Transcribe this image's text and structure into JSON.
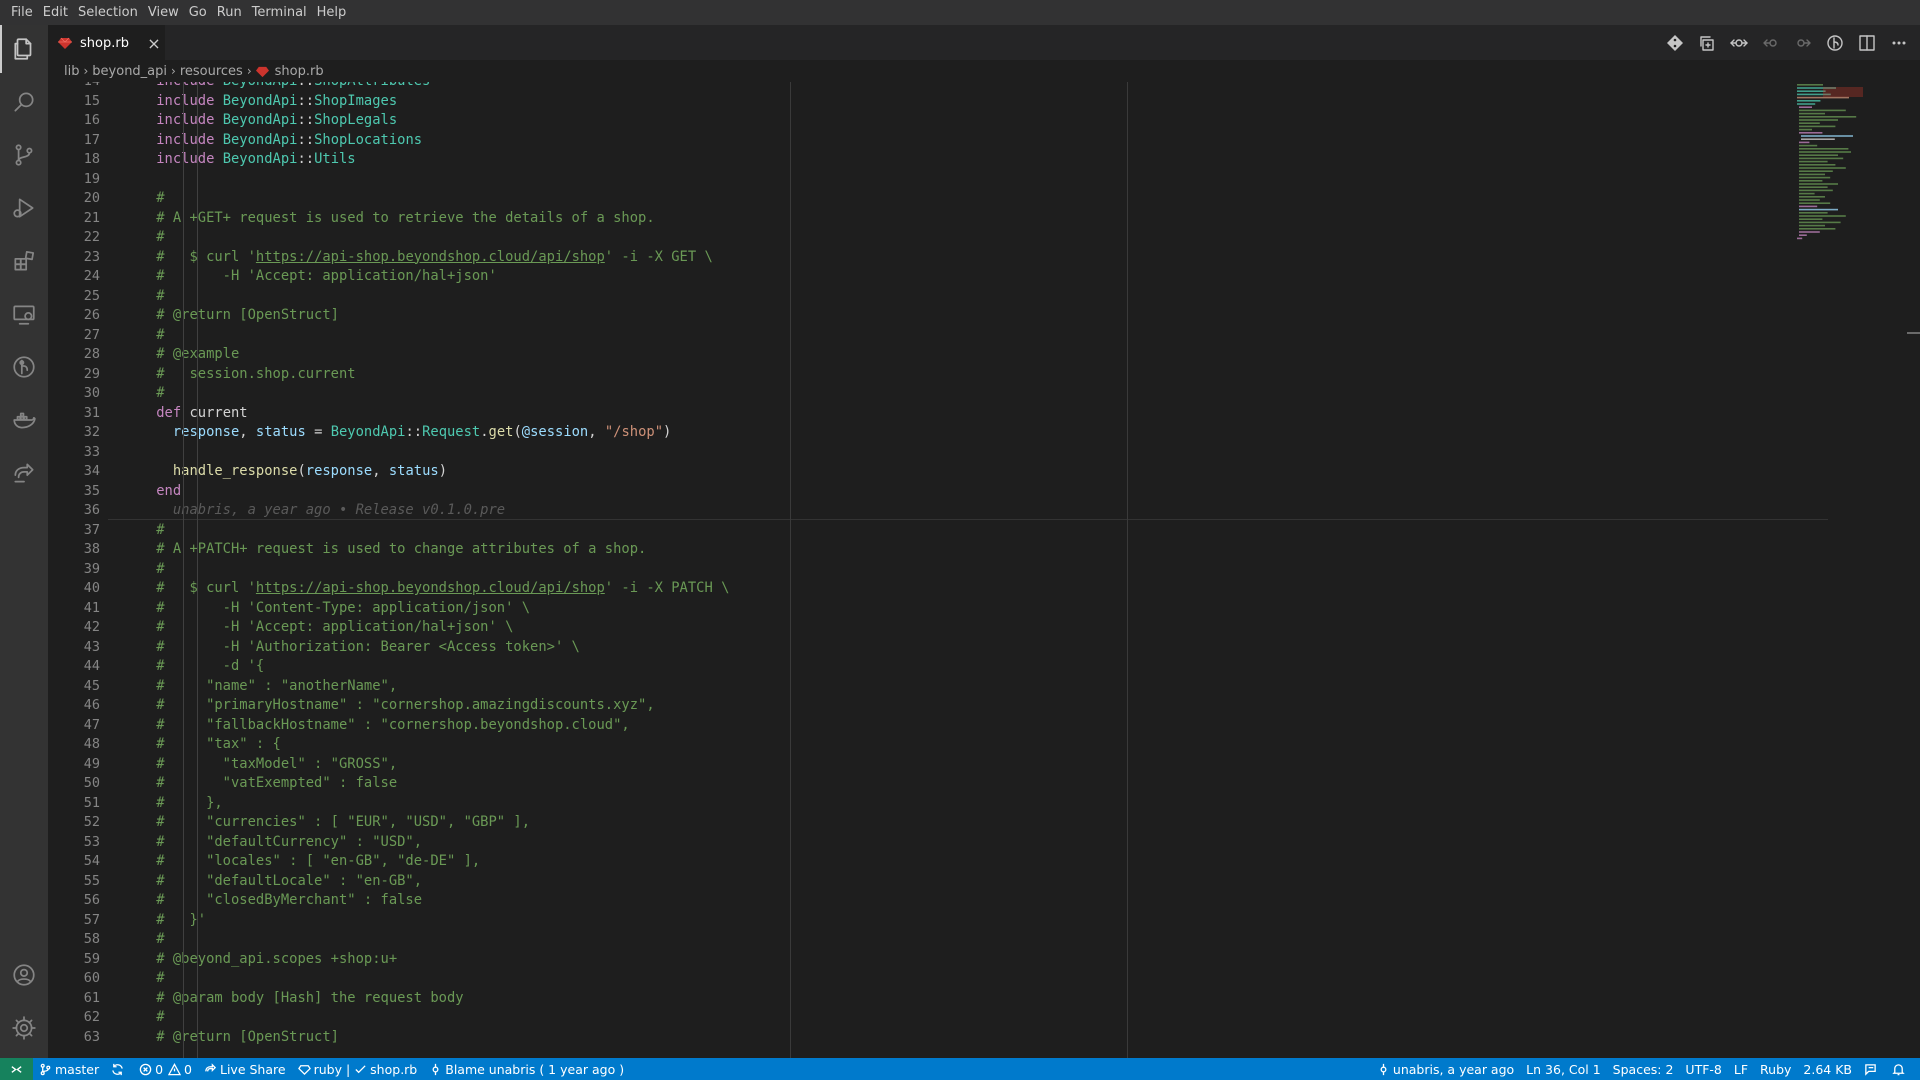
{
  "menu": [
    "File",
    "Edit",
    "Selection",
    "View",
    "Go",
    "Run",
    "Terminal",
    "Help"
  ],
  "tab": {
    "label": "shop.rb",
    "close": "×"
  },
  "breadcrumb": [
    "lib",
    "beyond_api",
    "resources",
    "shop.rb"
  ],
  "activity_icons": [
    "explorer-icon",
    "search-icon",
    "source-control-icon",
    "run-debug-icon",
    "extensions-icon",
    "remote-explorer-icon",
    "gitlens-icon",
    "docker-icon",
    "live-share-icon",
    "accounts-icon",
    "settings-gear-icon"
  ],
  "editor_action_icons": [
    "gitlens-compare-icon",
    "open-changes-icon",
    "toggle-blame-icon",
    "previous-change-icon",
    "next-change-icon",
    "gitlens-inspect-icon",
    "split-editor-icon",
    "more-actions-icon"
  ],
  "editor": {
    "first_line_number": 14,
    "blame_inline": "unabris, a year ago • Release v0.1.0.pre",
    "lines": [
      [
        [
          "    ",
          "plain"
        ],
        [
          "include ",
          "kw"
        ],
        [
          "BeyondApi",
          "cls"
        ],
        [
          "::",
          "plain"
        ],
        [
          "ShopAttributes",
          "cls"
        ]
      ],
      [
        [
          "    ",
          "plain"
        ],
        [
          "include ",
          "kw"
        ],
        [
          "BeyondApi",
          "cls"
        ],
        [
          "::",
          "plain"
        ],
        [
          "ShopImages",
          "cls"
        ]
      ],
      [
        [
          "    ",
          "plain"
        ],
        [
          "include ",
          "kw"
        ],
        [
          "BeyondApi",
          "cls"
        ],
        [
          "::",
          "plain"
        ],
        [
          "ShopLegals",
          "cls"
        ]
      ],
      [
        [
          "    ",
          "plain"
        ],
        [
          "include ",
          "kw"
        ],
        [
          "BeyondApi",
          "cls"
        ],
        [
          "::",
          "plain"
        ],
        [
          "ShopLocations",
          "cls"
        ]
      ],
      [
        [
          "    ",
          "plain"
        ],
        [
          "include ",
          "kw"
        ],
        [
          "BeyondApi",
          "cls"
        ],
        [
          "::",
          "plain"
        ],
        [
          "Utils",
          "cls"
        ]
      ],
      [],
      [
        [
          "    ",
          "plain"
        ],
        [
          "#",
          "cm"
        ]
      ],
      [
        [
          "    ",
          "plain"
        ],
        [
          "# A +GET+ request is used to retrieve the details of a shop.",
          "cm"
        ]
      ],
      [
        [
          "    ",
          "plain"
        ],
        [
          "#",
          "cm"
        ]
      ],
      [
        [
          "    ",
          "plain"
        ],
        [
          "#   $ curl '",
          "cm"
        ],
        [
          "https://api-shop.beyondshop.cloud/api/shop",
          "cm url"
        ],
        [
          "' -i -X GET \\",
          "cm"
        ]
      ],
      [
        [
          "    ",
          "plain"
        ],
        [
          "#       -H 'Accept: application/hal+json'",
          "cm"
        ]
      ],
      [
        [
          "    ",
          "plain"
        ],
        [
          "#",
          "cm"
        ]
      ],
      [
        [
          "    ",
          "plain"
        ],
        [
          "# @return [OpenStruct]",
          "cm"
        ]
      ],
      [
        [
          "    ",
          "plain"
        ],
        [
          "#",
          "cm"
        ]
      ],
      [
        [
          "    ",
          "plain"
        ],
        [
          "# @example",
          "cm"
        ]
      ],
      [
        [
          "    ",
          "plain"
        ],
        [
          "#   session.shop.current",
          "cm"
        ]
      ],
      [
        [
          "    ",
          "plain"
        ],
        [
          "#",
          "cm"
        ]
      ],
      [
        [
          "    ",
          "plain"
        ],
        [
          "def ",
          "kw"
        ],
        [
          "current",
          "plain"
        ]
      ],
      [
        [
          "      ",
          "plain"
        ],
        [
          "response",
          "var"
        ],
        [
          ", ",
          "plain"
        ],
        [
          "status",
          "var"
        ],
        [
          " = ",
          "plain"
        ],
        [
          "BeyondApi",
          "cls"
        ],
        [
          "::",
          "plain"
        ],
        [
          "Request",
          "cls"
        ],
        [
          ".",
          "plain"
        ],
        [
          "get",
          "fn"
        ],
        [
          "(",
          "plain"
        ],
        [
          "@session",
          "ivar"
        ],
        [
          ", ",
          "plain"
        ],
        [
          "\"/shop\"",
          "str"
        ],
        [
          ")",
          "plain"
        ]
      ],
      [],
      [
        [
          "      ",
          "plain"
        ],
        [
          "handle_response",
          "fn"
        ],
        [
          "(",
          "plain"
        ],
        [
          "response",
          "var"
        ],
        [
          ", ",
          "plain"
        ],
        [
          "status",
          "var"
        ],
        [
          ")",
          "plain"
        ]
      ],
      [
        [
          "    ",
          "plain"
        ],
        [
          "end",
          "kw"
        ]
      ],
      [
        [
          "      ",
          "plain"
        ],
        [
          "unabris, a year ago • Release v0.1.0.pre",
          "blame"
        ]
      ],
      [
        [
          "    ",
          "plain"
        ],
        [
          "#",
          "cm"
        ]
      ],
      [
        [
          "    ",
          "plain"
        ],
        [
          "# A +PATCH+ request is used to change attributes of a shop.",
          "cm"
        ]
      ],
      [
        [
          "    ",
          "plain"
        ],
        [
          "#",
          "cm"
        ]
      ],
      [
        [
          "    ",
          "plain"
        ],
        [
          "#   $ curl '",
          "cm"
        ],
        [
          "https://api-shop.beyondshop.cloud/api/shop",
          "cm url"
        ],
        [
          "' -i -X PATCH \\",
          "cm"
        ]
      ],
      [
        [
          "    ",
          "plain"
        ],
        [
          "#       -H 'Content-Type: application/json' \\",
          "cm"
        ]
      ],
      [
        [
          "    ",
          "plain"
        ],
        [
          "#       -H 'Accept: application/hal+json' \\",
          "cm"
        ]
      ],
      [
        [
          "    ",
          "plain"
        ],
        [
          "#       -H 'Authorization: Bearer <Access token>' \\",
          "cm"
        ]
      ],
      [
        [
          "    ",
          "plain"
        ],
        [
          "#       -d '{",
          "cm"
        ]
      ],
      [
        [
          "    ",
          "plain"
        ],
        [
          "#     \"name\" : \"anotherName\",",
          "cm"
        ]
      ],
      [
        [
          "    ",
          "plain"
        ],
        [
          "#     \"primaryHostname\" : \"cornershop.amazingdiscounts.xyz\",",
          "cm"
        ]
      ],
      [
        [
          "    ",
          "plain"
        ],
        [
          "#     \"fallbackHostname\" : \"cornershop.beyondshop.cloud\",",
          "cm"
        ]
      ],
      [
        [
          "    ",
          "plain"
        ],
        [
          "#     \"tax\" : {",
          "cm"
        ]
      ],
      [
        [
          "    ",
          "plain"
        ],
        [
          "#       \"taxModel\" : \"GROSS\",",
          "cm"
        ]
      ],
      [
        [
          "    ",
          "plain"
        ],
        [
          "#       \"vatExempted\" : false",
          "cm"
        ]
      ],
      [
        [
          "    ",
          "plain"
        ],
        [
          "#     },",
          "cm"
        ]
      ],
      [
        [
          "    ",
          "plain"
        ],
        [
          "#     \"currencies\" : [ \"EUR\", \"USD\", \"GBP\" ],",
          "cm"
        ]
      ],
      [
        [
          "    ",
          "plain"
        ],
        [
          "#     \"defaultCurrency\" : \"USD\",",
          "cm"
        ]
      ],
      [
        [
          "    ",
          "plain"
        ],
        [
          "#     \"locales\" : [ \"en-GB\", \"de-DE\" ],",
          "cm"
        ]
      ],
      [
        [
          "    ",
          "plain"
        ],
        [
          "#     \"defaultLocale\" : \"en-GB\",",
          "cm"
        ]
      ],
      [
        [
          "    ",
          "plain"
        ],
        [
          "#     \"closedByMerchant\" : false",
          "cm"
        ]
      ],
      [
        [
          "    ",
          "plain"
        ],
        [
          "#   }'",
          "cm"
        ]
      ],
      [
        [
          "    ",
          "plain"
        ],
        [
          "#",
          "cm"
        ]
      ],
      [
        [
          "    ",
          "plain"
        ],
        [
          "# @beyond_api.scopes +shop:u+",
          "cm"
        ]
      ],
      [
        [
          "    ",
          "plain"
        ],
        [
          "#",
          "cm"
        ]
      ],
      [
        [
          "    ",
          "plain"
        ],
        [
          "# @param body [Hash] the request body",
          "cm"
        ]
      ],
      [
        [
          "    ",
          "plain"
        ],
        [
          "#",
          "cm"
        ]
      ],
      [
        [
          "    ",
          "plain"
        ],
        [
          "# @return [OpenStruct]",
          "cm"
        ]
      ]
    ]
  },
  "status": {
    "branch": "master",
    "errors": "0",
    "warnings": "0",
    "live_share": "Live Share",
    "ruby": "ruby |",
    "lint_file": "shop.rb",
    "blame": "Blame unabris ( 1 year ago )",
    "author": "unabris, a year ago",
    "position": "Ln 36, Col 1",
    "spaces": "Spaces: 2",
    "encoding": "UTF-8",
    "eol": "LF",
    "language": "Ruby",
    "size": "2.64 KB"
  },
  "colors": {
    "statusbar": "#007acc",
    "remote": "#16825d",
    "editor_bg": "#1e1e1e",
    "keyword": "#c586c0",
    "class": "#4ec9b0",
    "comment": "#6a9955",
    "string": "#ce9178"
  }
}
